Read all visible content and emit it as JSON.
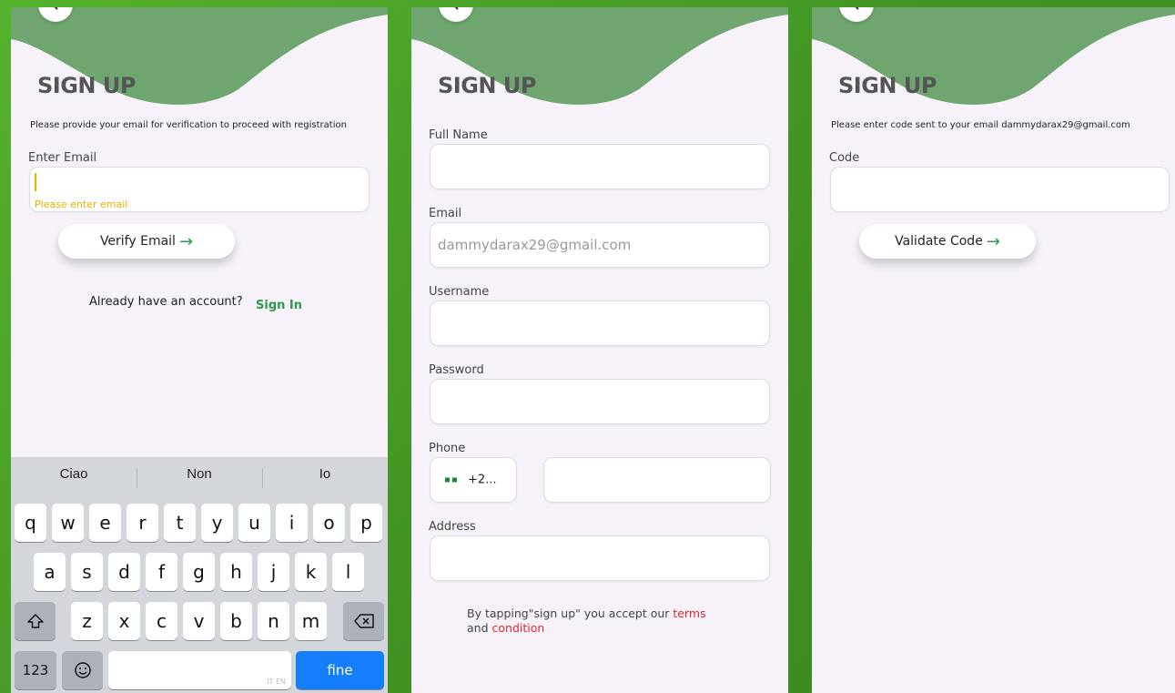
{
  "colors": {
    "accent": "#6fa66f",
    "link": "#2e9a4a",
    "error": "#e9b100",
    "terms": "#e0262b",
    "keyboard_blue": "#157efb"
  },
  "screen1": {
    "title": "SIGN UP",
    "info": "Please provide your email for verification to proceed with registration",
    "email_label": "Enter Email",
    "email_error": "Please enter email",
    "verify_button": "Verify Email",
    "have_account": "Already have an account?",
    "sign_in": "Sign In",
    "keyboard": {
      "suggestions": [
        "Ciao",
        "Non",
        "Io"
      ],
      "row1": [
        "q",
        "w",
        "e",
        "r",
        "t",
        "y",
        "u",
        "i",
        "o",
        "p"
      ],
      "row2": [
        "a",
        "s",
        "d",
        "f",
        "g",
        "h",
        "j",
        "k",
        "l"
      ],
      "row3": [
        "z",
        "x",
        "c",
        "v",
        "b",
        "n",
        "m"
      ],
      "numbers": "123",
      "space_hint": "IT EN",
      "return": "fine"
    }
  },
  "screen2": {
    "title": "SIGN UP",
    "full_name_label": "Full Name",
    "email_label": "Email",
    "email_value": "dammydarax29@gmail.com",
    "username_label": "Username",
    "password_label": "Password",
    "phone_label": "Phone",
    "country_code": "+2...",
    "address_label": "Address",
    "tos_prefix": "By tapping\"sign up\" you accept our ",
    "terms": "terms",
    "and": "and ",
    "condition": "condition"
  },
  "screen3": {
    "title": "SIGN UP",
    "info": "Please enter code sent to your email dammydarax29@gmail.com",
    "code_label": "Code",
    "validate_button": "Validate Code"
  }
}
